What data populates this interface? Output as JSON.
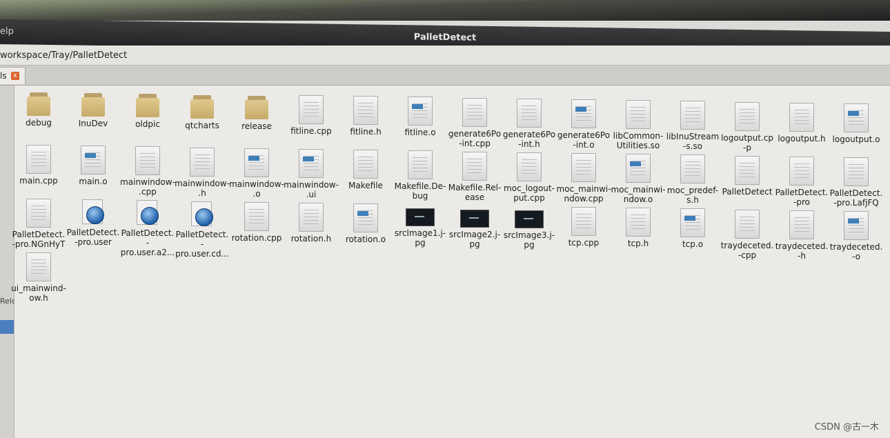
{
  "window": {
    "title": "PalletDetect",
    "menu_help": "elp"
  },
  "pathbar": {
    "path": "workspace/Tray/PalletDetect"
  },
  "tab": {
    "label": "ls",
    "close": "x"
  },
  "sidebar": {
    "label": "Relc"
  },
  "files": [
    {
      "name": "debug",
      "type": "folder"
    },
    {
      "name": "InuDev",
      "type": "folder"
    },
    {
      "name": "oldpic",
      "type": "folder"
    },
    {
      "name": "qtcharts",
      "type": "folder"
    },
    {
      "name": "release",
      "type": "folder"
    },
    {
      "name": "fitline.cpp",
      "type": "doc"
    },
    {
      "name": "fitline.h",
      "type": "doc"
    },
    {
      "name": "fitline.o",
      "type": "obj"
    },
    {
      "name": "generate6Po-int.cpp",
      "type": "doc"
    },
    {
      "name": "generate6Po-int.h",
      "type": "doc"
    },
    {
      "name": "generate6Po-int.o",
      "type": "obj"
    },
    {
      "name": "libCommon-Utilities.so",
      "type": "doc"
    },
    {
      "name": "libInuStream-s.so",
      "type": "doc"
    },
    {
      "name": "logoutput.cp-p",
      "type": "doc"
    },
    {
      "name": "logoutput.h",
      "type": "doc"
    },
    {
      "name": "logoutput.o",
      "type": "obj"
    },
    {
      "name": "main.cpp",
      "type": "doc"
    },
    {
      "name": "main.o",
      "type": "obj"
    },
    {
      "name": "mainwindow-.cpp",
      "type": "doc"
    },
    {
      "name": "mainwindow-.h",
      "type": "doc"
    },
    {
      "name": "mainwindow-.o",
      "type": "obj"
    },
    {
      "name": "mainwindow-.ui",
      "type": "obj"
    },
    {
      "name": "Makefile",
      "type": "doc"
    },
    {
      "name": "Makefile.De-bug",
      "type": "doc"
    },
    {
      "name": "Makefile.Rel-ease",
      "type": "doc"
    },
    {
      "name": "moc_logout-put.cpp",
      "type": "doc"
    },
    {
      "name": "moc_mainwi-ndow.cpp",
      "type": "doc"
    },
    {
      "name": "moc_mainwi-ndow.o",
      "type": "obj"
    },
    {
      "name": "moc_predef-s.h",
      "type": "doc"
    },
    {
      "name": "PalletDetect",
      "type": "doc"
    },
    {
      "name": "PalletDetect.-pro",
      "type": "doc"
    },
    {
      "name": "PalletDetect.-pro.LafjFQ",
      "type": "doc"
    },
    {
      "name": "PalletDetect.-pro.NGnHyT",
      "type": "doc"
    },
    {
      "name": "PalletDetect.-pro.user",
      "type": "user"
    },
    {
      "name": "PalletDetect.-pro.user.a2...",
      "type": "user"
    },
    {
      "name": "PalletDetect.-pro.user.cd...",
      "type": "user"
    },
    {
      "name": "rotation.cpp",
      "type": "doc"
    },
    {
      "name": "rotation.h",
      "type": "doc"
    },
    {
      "name": "rotation.o",
      "type": "obj"
    },
    {
      "name": "srcImage1.j-pg",
      "type": "thumb"
    },
    {
      "name": "srcImage2.j-pg",
      "type": "thumb"
    },
    {
      "name": "srcImage3.j-pg",
      "type": "thumb"
    },
    {
      "name": "tcp.cpp",
      "type": "doc"
    },
    {
      "name": "tcp.h",
      "type": "doc"
    },
    {
      "name": "tcp.o",
      "type": "obj"
    },
    {
      "name": "traydeceted.-cpp",
      "type": "doc"
    },
    {
      "name": "traydeceted.-h",
      "type": "doc"
    },
    {
      "name": "traydeceted.-o",
      "type": "obj"
    },
    {
      "name": "ui_mainwind-ow.h",
      "type": "doc"
    }
  ],
  "watermark": "CSDN @古一木"
}
